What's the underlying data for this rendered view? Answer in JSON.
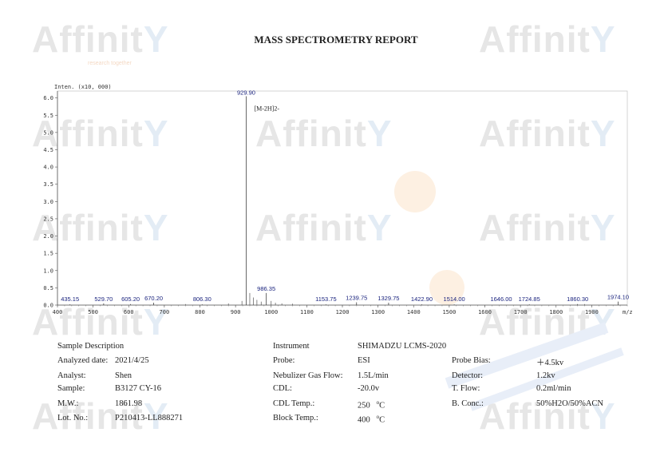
{
  "report_title": "MASS SPECTROMETRY REPORT",
  "watermark": {
    "brand": "Affinit",
    "tagline": "research together"
  },
  "colors": {
    "peak_label": "#1a237e",
    "axis": "#555555",
    "watermark": "#e6e6e6",
    "accent": "#f7c893"
  },
  "chart_data": {
    "type": "bar",
    "title": "",
    "y_axis_unit": "Inten. (x10, 000)",
    "xlabel": "m/z",
    "ylabel": "",
    "xlim": [
      400,
      2000
    ],
    "ylim": [
      0,
      6.2
    ],
    "x_ticks": [
      400,
      500,
      600,
      700,
      800,
      900,
      1000,
      1100,
      1200,
      1300,
      1400,
      1500,
      1600,
      1700,
      1800,
      1900
    ],
    "y_ticks": [
      "0.0",
      "0.5",
      "1.0",
      "1.5",
      "2.0",
      "2.5",
      "3.0",
      "3.5",
      "4.0",
      "4.5",
      "5.0",
      "5.5",
      "6.0"
    ],
    "y_tick_values": [
      0,
      0.5,
      1,
      1.5,
      2,
      2.5,
      3,
      3.5,
      4,
      4.5,
      5,
      5.5,
      6
    ],
    "annotation": "[M-2H]2-",
    "peaks": [
      {
        "mz": 435.15,
        "label": "435.15",
        "intensity": 0.02
      },
      {
        "mz": 529.7,
        "label": "529.70",
        "intensity": 0.05
      },
      {
        "mz": 605.2,
        "label": "605.20",
        "intensity": 0.03
      },
      {
        "mz": 670.2,
        "label": "670.20",
        "intensity": 0.07
      },
      {
        "mz": 806.3,
        "label": "806.30",
        "intensity": 0.02
      },
      {
        "mz": 929.9,
        "label": "929.90",
        "intensity": 6.05
      },
      {
        "mz": 986.35,
        "label": "986.35",
        "intensity": 0.35
      },
      {
        "mz": 1153.75,
        "label": "1153.75",
        "intensity": 0.02
      },
      {
        "mz": 1239.75,
        "label": "1239.75",
        "intensity": 0.08
      },
      {
        "mz": 1329.75,
        "label": "1329.75",
        "intensity": 0.07
      },
      {
        "mz": 1422.9,
        "label": "1422.90",
        "intensity": 0.02
      },
      {
        "mz": 1514.0,
        "label": "1514.00",
        "intensity": 0.02
      },
      {
        "mz": 1646.0,
        "label": "1646.00",
        "intensity": 0.01
      },
      {
        "mz": 1724.85,
        "label": "1724.85",
        "intensity": 0.02
      },
      {
        "mz": 1860.3,
        "label": "1860.30",
        "intensity": 0.03
      },
      {
        "mz": 1974.1,
        "label": "1974.10",
        "intensity": 0.1
      }
    ],
    "minor_peaks": [
      {
        "mz": 918,
        "intensity": 0.12
      },
      {
        "mz": 940,
        "intensity": 0.35
      },
      {
        "mz": 950,
        "intensity": 0.22
      },
      {
        "mz": 960,
        "intensity": 0.15
      },
      {
        "mz": 972,
        "intensity": 0.1
      },
      {
        "mz": 1000,
        "intensity": 0.12
      },
      {
        "mz": 1012,
        "intensity": 0.07
      },
      {
        "mz": 1030,
        "intensity": 0.05
      },
      {
        "mz": 880,
        "intensity": 0.05
      },
      {
        "mz": 1060,
        "intensity": 0.04
      },
      {
        "mz": 760,
        "intensity": 0.03
      },
      {
        "mz": 1880,
        "intensity": 0.03
      }
    ]
  },
  "sample": {
    "section": "Sample Description",
    "analyzed_date_label": "Analyzed date:",
    "analyzed_date": "2021/4/25",
    "analyst_label": "Analyst:",
    "analyst": "Shen",
    "sample_label": "Sample:",
    "sample": "B3127 CY-16",
    "mw_label": "M.W.:",
    "mw": "1861.98",
    "lot_label": "Lot. No.:",
    "lot": "P210413-LL888271"
  },
  "instrument": {
    "label": "Instrument",
    "value": "SHIMADZU LCMS-2020",
    "probe_label": "Probe:",
    "probe": "ESI",
    "nebulizer_label": "Nebulizer Gas Flow:",
    "nebulizer": "1.5L/min",
    "cdl_label": "CDL:",
    "cdl": "-20.0v",
    "cdl_temp_label": "CDL Temp.:",
    "cdl_temp": "250",
    "block_temp_label": "Block Temp.:",
    "block_temp": "400",
    "temp_unit": "C",
    "temp_sup": "o",
    "probe_bias_label": "Probe Bias:",
    "probe_bias": "＋4.5kv",
    "detector_label": "Detector:",
    "detector": "1.2kv",
    "tflow_label": "T. Flow:",
    "tflow": "0.2ml/min",
    "bconc_label": "B. Conc.:",
    "bconc": "50%H2O/50%ACN"
  }
}
